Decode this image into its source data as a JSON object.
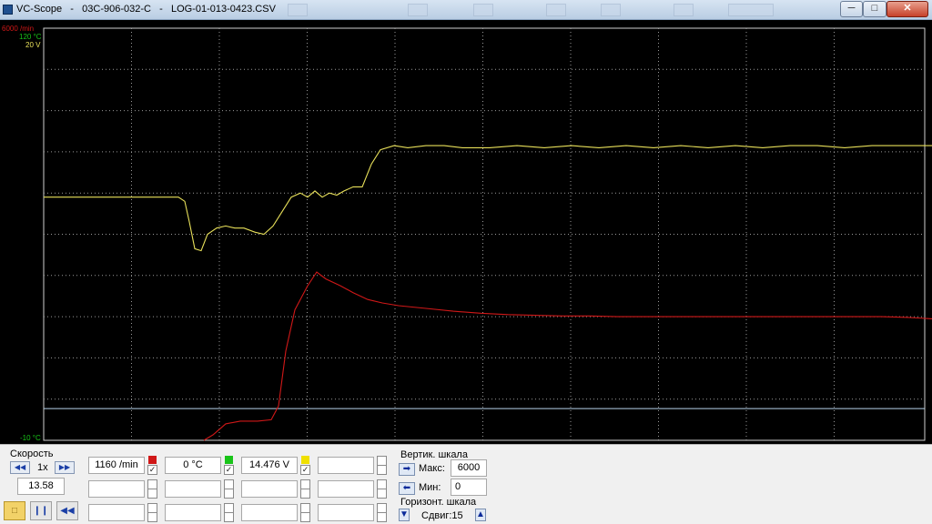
{
  "window": {
    "title": "VC-Scope   -   03C-906-032-C   -   LOG-01-013-0423.CSV",
    "minimize_glyph": "─",
    "maximize_glyph": "□",
    "close_glyph": "✕"
  },
  "scope": {
    "axis_labels": {
      "rpm": "6000 /min",
      "temp": "120 °C",
      "volt": "20 V",
      "min": "-10 °C"
    },
    "colors": {
      "rpm": "#d01818",
      "temp": "#19c419",
      "volt": "#e8e05a",
      "grid": "#9a9a9a",
      "baseline": "#b7d2ea"
    }
  },
  "chart_data": {
    "type": "line",
    "series": [
      {
        "name": "",
        "color": "#e8e05a",
        "points": [
          [
            0,
            11.8
          ],
          [
            148,
            11.8
          ],
          [
            155,
            11.6
          ],
          [
            160,
            10.6
          ],
          [
            166,
            9.3
          ],
          [
            173,
            9.2
          ],
          [
            180,
            10.0
          ],
          [
            190,
            10.3
          ],
          [
            200,
            10.4
          ],
          [
            210,
            10.3
          ],
          [
            220,
            10.3
          ],
          [
            232,
            10.1
          ],
          [
            242,
            10.0
          ],
          [
            252,
            10.4
          ],
          [
            262,
            11.1
          ],
          [
            272,
            11.8
          ],
          [
            282,
            12.0
          ],
          [
            290,
            11.8
          ],
          [
            298,
            12.1
          ],
          [
            306,
            11.8
          ],
          [
            314,
            12.0
          ],
          [
            322,
            11.9
          ],
          [
            330,
            12.1
          ],
          [
            340,
            12.3
          ],
          [
            350,
            12.3
          ],
          [
            360,
            13.4
          ],
          [
            370,
            14.1
          ],
          [
            385,
            14.3
          ],
          [
            400,
            14.2
          ],
          [
            420,
            14.3
          ],
          [
            440,
            14.3
          ],
          [
            460,
            14.2
          ],
          [
            490,
            14.2
          ],
          [
            520,
            14.3
          ],
          [
            550,
            14.2
          ],
          [
            580,
            14.3
          ],
          [
            610,
            14.2
          ],
          [
            640,
            14.3
          ],
          [
            670,
            14.2
          ],
          [
            700,
            14.3
          ],
          [
            730,
            14.2
          ],
          [
            760,
            14.3
          ],
          [
            790,
            14.2
          ],
          [
            820,
            14.3
          ],
          [
            850,
            14.3
          ],
          [
            880,
            14.2
          ],
          [
            910,
            14.3
          ],
          [
            940,
            14.3
          ],
          [
            976,
            14.3
          ]
        ]
      },
      {
        "name": "",
        "color": "#d01818",
        "points": [
          [
            176,
            0
          ],
          [
            186,
            80
          ],
          [
            200,
            240
          ],
          [
            216,
            280
          ],
          [
            235,
            280
          ],
          [
            250,
            300
          ],
          [
            258,
            500
          ],
          [
            266,
            1300
          ],
          [
            276,
            1900
          ],
          [
            290,
            2250
          ],
          [
            300,
            2450
          ],
          [
            310,
            2350
          ],
          [
            326,
            2250
          ],
          [
            340,
            2150
          ],
          [
            356,
            2050
          ],
          [
            372,
            2000
          ],
          [
            390,
            1960
          ],
          [
            420,
            1920
          ],
          [
            450,
            1880
          ],
          [
            480,
            1850
          ],
          [
            510,
            1830
          ],
          [
            540,
            1820
          ],
          [
            570,
            1810
          ],
          [
            600,
            1810
          ],
          [
            630,
            1800
          ],
          [
            660,
            1800
          ],
          [
            690,
            1800
          ],
          [
            720,
            1800
          ],
          [
            760,
            1800
          ],
          [
            800,
            1800
          ],
          [
            840,
            1800
          ],
          [
            880,
            1800
          ],
          [
            920,
            1800
          ],
          [
            950,
            1790
          ],
          [
            976,
            1770
          ]
        ]
      }
    ],
    "y_ranges": {
      "rpm": [
        0,
        6000
      ],
      "temp": [
        -10,
        120
      ],
      "volt": [
        0,
        20
      ]
    },
    "grid": true
  },
  "panel": {
    "speed": {
      "label": "Скорость",
      "value": "1x",
      "time": "13.58"
    },
    "channels": [
      {
        "value": "1160 /min",
        "color": "#d01818",
        "checked": "✓"
      },
      {
        "value": "0 °C",
        "color": "#19c419",
        "checked": "✓"
      },
      {
        "value": "14.476 V",
        "color": "#f0e000",
        "checked": "✓"
      },
      {
        "value": "",
        "color": "",
        "checked": ""
      }
    ],
    "vscale": {
      "label": "Вертик. шкала",
      "max_label": "Макс:",
      "max_value": "6000",
      "min_label": "Мин:",
      "min_value": "0"
    },
    "hscale": {
      "label": "Горизонт. шкала",
      "shift_label": "Сдвиг:15"
    },
    "icons": {
      "rewind": "◀◀",
      "forward": "▶▶",
      "pause": "❙❙",
      "arrow_right": "➡",
      "arrow_left": "⬅",
      "spin_up": "▲",
      "spin_down": "▼"
    }
  }
}
